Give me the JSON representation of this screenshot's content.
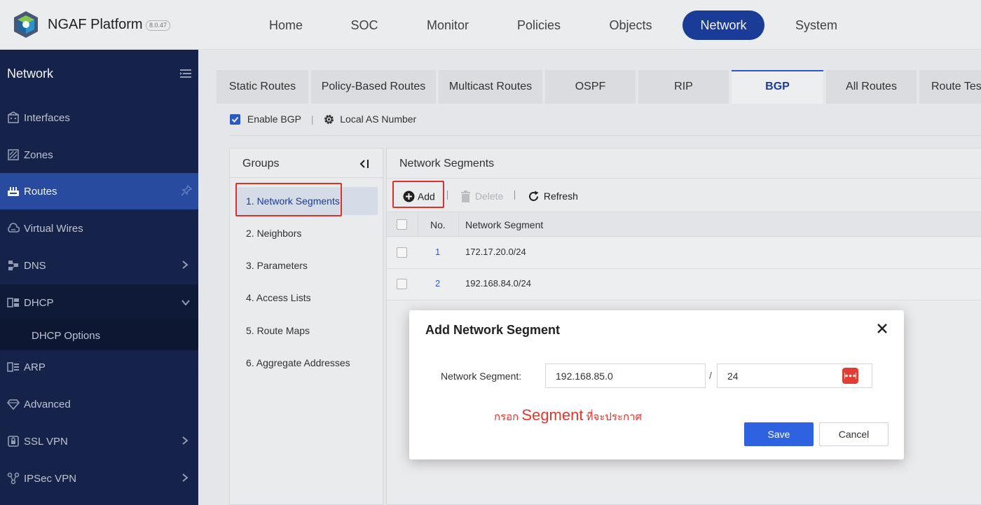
{
  "app": {
    "brand": "NGAF Platform",
    "version": "8.0.47"
  },
  "topnav": [
    {
      "label": "Home"
    },
    {
      "label": "SOC"
    },
    {
      "label": "Monitor"
    },
    {
      "label": "Policies"
    },
    {
      "label": "Objects"
    },
    {
      "label": "Network",
      "active": true
    },
    {
      "label": "System"
    }
  ],
  "sidebar": {
    "title": "Network",
    "items": [
      {
        "label": "Interfaces",
        "icon": "building-icon"
      },
      {
        "label": "Zones",
        "icon": "zone-icon"
      },
      {
        "label": "Routes",
        "icon": "router-icon",
        "active": true
      },
      {
        "label": "Virtual Wires",
        "icon": "cloud-icon"
      },
      {
        "label": "DNS",
        "icon": "dns-icon"
      },
      {
        "label": "DHCP",
        "icon": "dhcp-icon",
        "expanded": true
      },
      {
        "label": "ARP",
        "icon": "arp-icon"
      },
      {
        "label": "Advanced",
        "icon": "diamond-icon"
      },
      {
        "label": "SSL VPN",
        "icon": "ssl-icon"
      },
      {
        "label": "IPSec VPN",
        "icon": "ipsec-icon"
      }
    ],
    "dhcp_sub": "DHCP Options"
  },
  "tabs": [
    {
      "label": "Static Routes"
    },
    {
      "label": "Policy-Based Routes"
    },
    {
      "label": "Multicast Routes"
    },
    {
      "label": "OSPF"
    },
    {
      "label": "RIP"
    },
    {
      "label": "BGP",
      "active": true
    },
    {
      "label": "All Routes"
    },
    {
      "label": "Route Test"
    }
  ],
  "bgp": {
    "enable_label": "Enable BGP",
    "enabled": true,
    "local_as_label": "Local AS Number"
  },
  "groups": {
    "title": "Groups",
    "items": [
      {
        "label": "1. Network Segments",
        "active": true
      },
      {
        "label": "2. Neighbors"
      },
      {
        "label": "3. Parameters"
      },
      {
        "label": "4. Access Lists"
      },
      {
        "label": "5. Route Maps"
      },
      {
        "label": "6. Aggregate Addresses"
      }
    ]
  },
  "panel": {
    "title": "Network Segments",
    "toolbar": {
      "add": "Add",
      "delete": "Delete",
      "refresh": "Refresh"
    },
    "columns": {
      "no": "No.",
      "segment": "Network Segment"
    },
    "rows": [
      {
        "no": "1",
        "segment": "172.17.20.0/24"
      },
      {
        "no": "2",
        "segment": "192.168.84.0/24"
      }
    ]
  },
  "modal": {
    "title": "Add Network Segment",
    "field_label": "Network Segment:",
    "ip_value": "192.168.85.0",
    "mask_value": "24",
    "separator": "/",
    "save": "Save",
    "cancel": "Cancel"
  },
  "annotation": {
    "prefix": "กรอก ",
    "highlight": "Segment",
    "suffix": " ที่จะประกาศ"
  },
  "colors": {
    "primary": "#1c3f9e",
    "accent": "#2f62e0",
    "sidebar": "#16244d",
    "highlight": "#e8342b"
  }
}
